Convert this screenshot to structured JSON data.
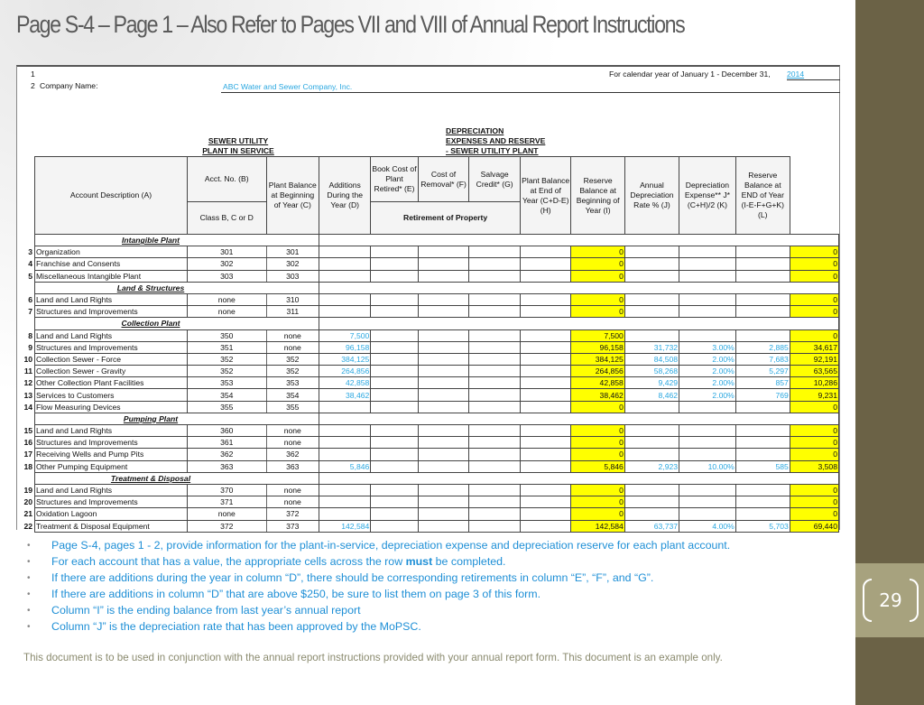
{
  "slide": {
    "title": "Page S-4 – Page 1 – Also Refer to Pages VII and VIII of Annual Report Instructions",
    "page_number": "29",
    "footer": "This document is to be used in conjunction with the annual report instructions provided with your annual report form.  This document is an example only.",
    "colors": {
      "sidebar": "#6b6246",
      "sidebar_band": "#a7a27e",
      "bullet_text": "#1e8fd6",
      "input_value": "#2aa7e0",
      "formula_cell": "#ffff00"
    }
  },
  "form": {
    "line1_no": "1",
    "line2_no": "2",
    "company_label": "Company Name:",
    "company_name": "ABC Water and Sewer Company, Inc.",
    "calendar_label": "For calendar year of January 1 - December 31,",
    "calendar_year": "2014",
    "section_plant": "SEWER UTILITY\nPLANT IN SERVICE",
    "section_plant_l1": "SEWER UTILITY",
    "section_plant_l2": "PLANT IN SERVICE",
    "section_dep_l1": "DEPRECIATION",
    "section_dep_l2": "EXPENSES AND RESERVE",
    "section_dep_l3": "- SEWER UTILITY PLANT",
    "headers": {
      "a": "Account Description (A)",
      "b": "Acct. No. (B)",
      "class": "Class B, C or D",
      "c": "Plant Balance at Beginning of Year (C)",
      "d": "Additions During the Year (D)",
      "e": "Book Cost of Plant Retired* (E)",
      "f": "Cost of Removal* (F)",
      "g": "Salvage Credit* (G)",
      "retirement": "Retirement of Property",
      "h": "Plant Balance at End of Year (C+D-E) (H)",
      "i": "Reserve Balance at Beginning of Year (I)",
      "j": "Annual Depreciation Rate % (J)",
      "k": "Depreciation Expense** J*(C+H)/2 (K)",
      "l": "Reserve Balance at END of Year (I-E-F+G+K) (L)"
    },
    "rows": [
      {
        "type": "section",
        "label": "Intangible Plant"
      },
      {
        "type": "row",
        "line": "3",
        "desc": "Organization",
        "acct": "301",
        "cls": "301",
        "c": "",
        "h": "0",
        "i": "",
        "j": "",
        "k": "",
        "l": "0"
      },
      {
        "type": "row",
        "line": "4",
        "desc": "Franchise and Consents",
        "acct": "302",
        "cls": "302",
        "c": "",
        "h": "0",
        "i": "",
        "j": "",
        "k": "",
        "l": "0"
      },
      {
        "type": "row",
        "line": "5",
        "desc": "Miscellaneous Intangible Plant",
        "acct": "303",
        "cls": "303",
        "c": "",
        "h": "0",
        "i": "",
        "j": "",
        "k": "",
        "l": "0"
      },
      {
        "type": "section",
        "label": "Land & Structures"
      },
      {
        "type": "row",
        "line": "6",
        "desc": "Land and Land Rights",
        "acct": "none",
        "cls": "310",
        "c": "",
        "h": "0",
        "i": "",
        "j": "",
        "k": "",
        "l": "0"
      },
      {
        "type": "row",
        "line": "7",
        "desc": "Structures and Improvements",
        "acct": "none",
        "cls": "311",
        "c": "",
        "h": "0",
        "i": "",
        "j": "",
        "k": "",
        "l": "0"
      },
      {
        "type": "section",
        "label": "Collection Plant"
      },
      {
        "type": "row",
        "line": "8",
        "desc": "Land and Land Rights",
        "acct": "350",
        "cls": "none",
        "c": "7,500",
        "h": "7,500",
        "i": "",
        "j": "",
        "k": "",
        "l": "0"
      },
      {
        "type": "row",
        "line": "9",
        "desc": "Structures and Improvements",
        "acct": "351",
        "cls": "none",
        "c": "96,158",
        "h": "96,158",
        "i": "31,732",
        "j": "3.00%",
        "k": "2,885",
        "l": "34,617"
      },
      {
        "type": "row",
        "line": "10",
        "desc": "Collection Sewer - Force",
        "acct": "352",
        "cls": "352",
        "c": "384,125",
        "h": "384,125",
        "i": "84,508",
        "j": "2.00%",
        "k": "7,683",
        "l": "92,191"
      },
      {
        "type": "row",
        "line": "11",
        "desc": "Collection Sewer - Gravity",
        "acct": "352",
        "cls": "352",
        "c": "264,856",
        "h": "264,856",
        "i": "58,268",
        "j": "2.00%",
        "k": "5,297",
        "l": "63,565"
      },
      {
        "type": "row",
        "line": "12",
        "desc": "Other Collection Plant Facilities",
        "acct": "353",
        "cls": "353",
        "c": "42,858",
        "h": "42,858",
        "i": "9,429",
        "j": "2.00%",
        "k": "857",
        "l": "10,286"
      },
      {
        "type": "row",
        "line": "13",
        "desc": "Services to Customers",
        "acct": "354",
        "cls": "354",
        "c": "38,462",
        "h": "38,462",
        "i": "8,462",
        "j": "2.00%",
        "k": "769",
        "l": "9,231"
      },
      {
        "type": "row",
        "line": "14",
        "desc": "Flow Measuring Devices",
        "acct": "355",
        "cls": "355",
        "c": "",
        "h": "0",
        "i": "",
        "j": "",
        "k": "",
        "l": "0"
      },
      {
        "type": "section",
        "label": "Pumping Plant"
      },
      {
        "type": "row",
        "line": "15",
        "desc": "Land and Land Rights",
        "acct": "360",
        "cls": "none",
        "c": "",
        "h": "0",
        "i": "",
        "j": "",
        "k": "",
        "l": "0"
      },
      {
        "type": "row",
        "line": "16",
        "desc": "Structures and Improvements",
        "acct": "361",
        "cls": "none",
        "c": "",
        "h": "0",
        "i": "",
        "j": "",
        "k": "",
        "l": "0"
      },
      {
        "type": "row",
        "line": "17",
        "desc": "Receiving Wells and Pump Pits",
        "acct": "362",
        "cls": "362",
        "c": "",
        "h": "0",
        "i": "",
        "j": "",
        "k": "",
        "l": "0"
      },
      {
        "type": "row",
        "line": "18",
        "desc": "Other Pumping Equipment",
        "acct": "363",
        "cls": "363",
        "c": "5,846",
        "h": "5,846",
        "i": "2,923",
        "j": "10.00%",
        "k": "585",
        "l": "3,508"
      },
      {
        "type": "section",
        "label": "Treatment & Disposal"
      },
      {
        "type": "row",
        "line": "19",
        "desc": "Land and Land Rights",
        "acct": "370",
        "cls": "none",
        "c": "",
        "h": "0",
        "i": "",
        "j": "",
        "k": "",
        "l": "0"
      },
      {
        "type": "row",
        "line": "20",
        "desc": "Structures and Improvements",
        "acct": "371",
        "cls": "none",
        "c": "",
        "h": "0",
        "i": "",
        "j": "",
        "k": "",
        "l": "0"
      },
      {
        "type": "row",
        "line": "21",
        "desc": "Oxidation Lagoon",
        "acct": "none",
        "cls": "372",
        "c": "",
        "h": "0",
        "i": "",
        "j": "",
        "k": "",
        "l": "0"
      },
      {
        "type": "row",
        "line": "22",
        "desc": "Treatment & Disposal Equipment",
        "acct": "372",
        "cls": "373",
        "c": "142,584",
        "h": "142,584",
        "i": "63,737",
        "j": "4.00%",
        "k": "5,703",
        "l": "69,440"
      }
    ]
  },
  "notes": [
    {
      "text": "Page S-4, pages 1 - 2, provide information for the plant-in-service, depreciation expense and depreciation reserve for each plant account."
    },
    {
      "pre": "For each account that has a value, the appropriate cells across the row ",
      "bold": "must",
      "post": " be completed."
    },
    {
      "text": "If there are additions during the year in column “D”, there should be corresponding retirements in column “E”, “F”, and “G”."
    },
    {
      "text": "If there are additions in column “D” that are above $250, be sure to list them on page 3 of this form."
    },
    {
      "text": "Column “I” is the ending balance from last year’s annual report"
    },
    {
      "text": "Column “J” is the depreciation rate that has been approved by the MoPSC."
    }
  ]
}
